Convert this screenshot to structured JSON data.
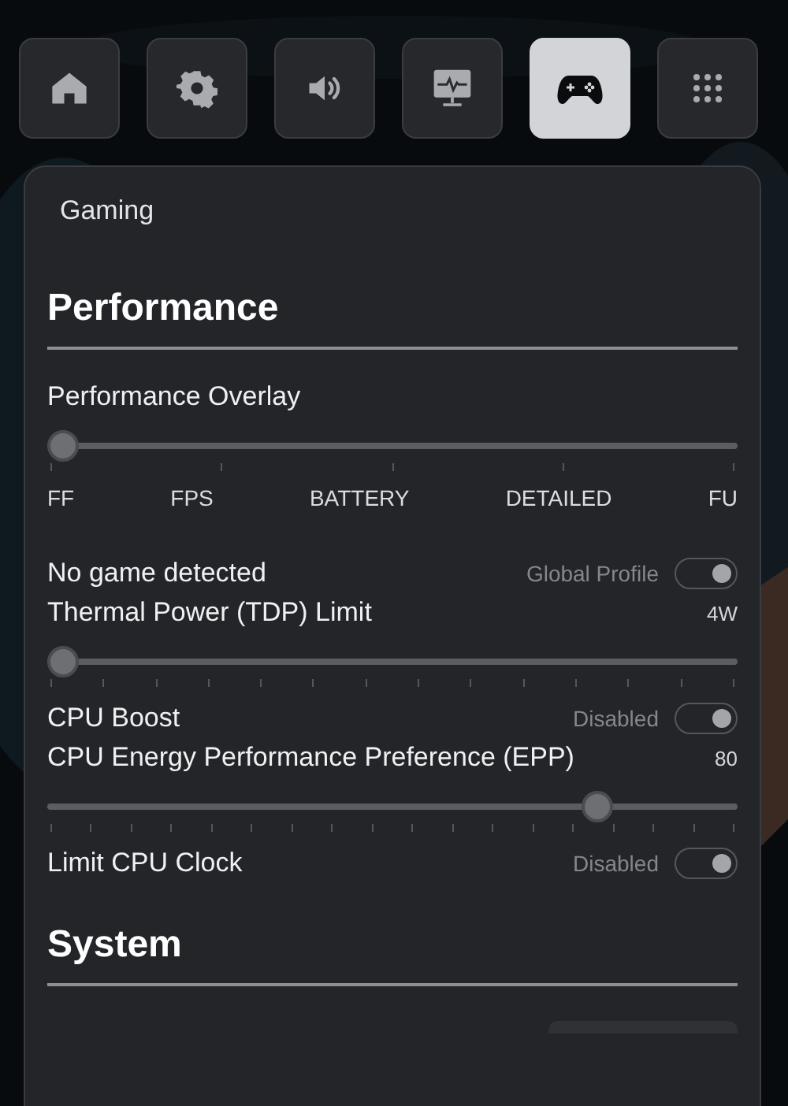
{
  "tabs": [
    {
      "kind": "home",
      "selected": false
    },
    {
      "kind": "settings",
      "selected": false
    },
    {
      "kind": "sound",
      "selected": false
    },
    {
      "kind": "monitor",
      "selected": false
    },
    {
      "kind": "gamepad",
      "selected": true
    },
    {
      "kind": "apps",
      "selected": false
    }
  ],
  "panel": {
    "title": "Gaming",
    "sections": [
      {
        "title": "Performance",
        "items": [
          {
            "kind": "select_slider",
            "label": "Performance Overlay",
            "level": 0,
            "options": [
              "FF",
              "FPS",
              "BATTERY",
              "DETAILED",
              "FU"
            ]
          },
          {
            "kind": "toggle",
            "label": "No game detected",
            "status": "Global Profile",
            "on": true
          },
          {
            "kind": "slider",
            "label": "Thermal Power (TDP) Limit",
            "value": "4W",
            "level": 0
          },
          {
            "kind": "toggle",
            "label": "CPU Boost",
            "status": "Disabled",
            "on": true
          },
          {
            "kind": "slider",
            "label": "CPU Energy Performance Preference (EPP)",
            "value": "80",
            "level": 0.81
          },
          {
            "kind": "toggle",
            "label": "Limit CPU Clock",
            "status": "Disabled",
            "on": true
          }
        ]
      },
      {
        "title": "System",
        "items": [
          {
            "kind": "partial"
          }
        ]
      }
    ]
  }
}
